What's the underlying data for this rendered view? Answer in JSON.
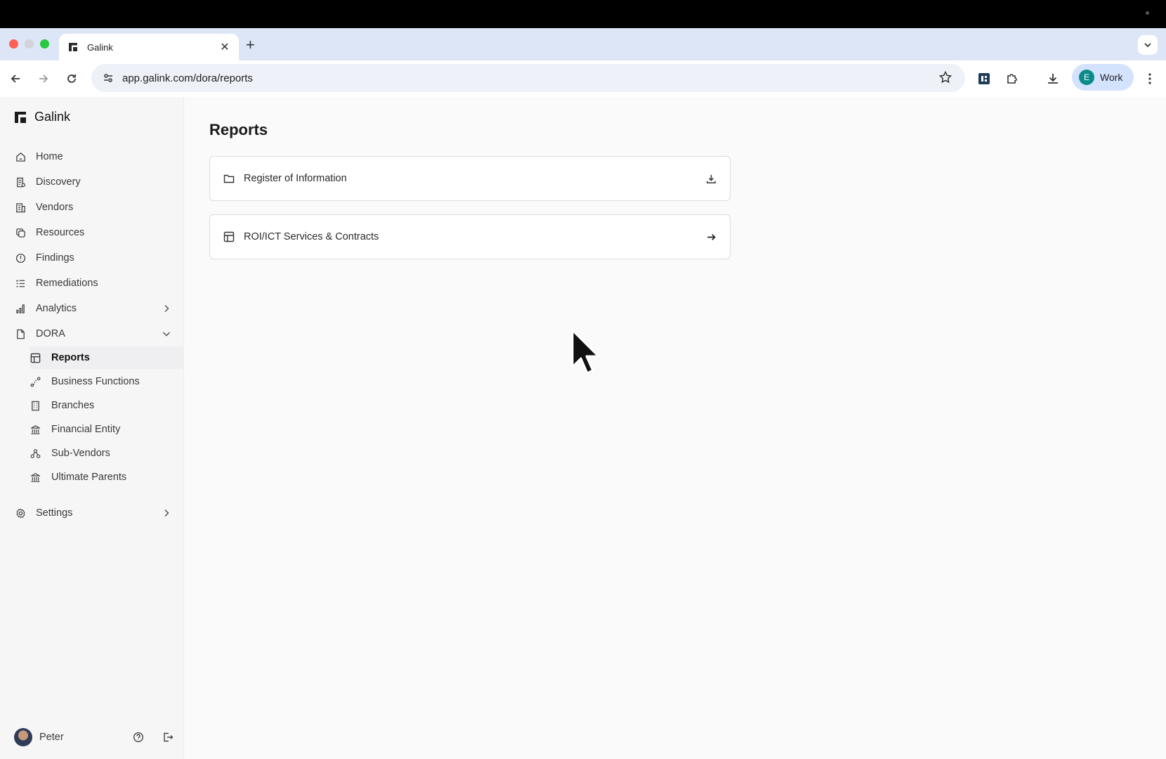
{
  "browser": {
    "tab_title": "Galink",
    "url": "app.galink.com/dora/reports",
    "profile_initial": "E",
    "profile_label": "Work",
    "profile_color": "#0b8a8a"
  },
  "sidebar": {
    "brand": "Galink",
    "items": [
      {
        "label": "Home",
        "icon": "home-icon"
      },
      {
        "label": "Discovery",
        "icon": "clipboard-icon"
      },
      {
        "label": "Vendors",
        "icon": "building-icon"
      },
      {
        "label": "Resources",
        "icon": "copy-icon"
      },
      {
        "label": "Findings",
        "icon": "alert-circle-icon"
      },
      {
        "label": "Remediations",
        "icon": "list-check-icon"
      },
      {
        "label": "Analytics",
        "icon": "bar-chart-icon"
      },
      {
        "label": "DORA",
        "icon": "file-icon"
      }
    ],
    "dora_sub": [
      {
        "label": "Reports",
        "icon": "table-icon",
        "active": true
      },
      {
        "label": "Business Functions",
        "icon": "workflow-icon"
      },
      {
        "label": "Branches",
        "icon": "building-small-icon"
      },
      {
        "label": "Financial Entity",
        "icon": "bank-icon"
      },
      {
        "label": "Sub-Vendors",
        "icon": "network-icon"
      },
      {
        "label": "Ultimate Parents",
        "icon": "bank-icon"
      }
    ],
    "settings": "Settings",
    "user": "Peter"
  },
  "main": {
    "title": "Reports",
    "cards": [
      {
        "label": "Register of Information",
        "icon": "folder-icon",
        "action": "download-icon"
      },
      {
        "label": "ROI/ICT Services & Contracts",
        "icon": "table-icon",
        "action": "arrow-right-icon"
      }
    ]
  }
}
